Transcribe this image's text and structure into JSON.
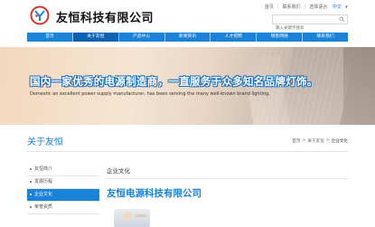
{
  "header": {
    "company_name": "友恒科技有限公司",
    "top_links": [
      "首页",
      "联系我们",
      "选择语言:",
      "中文"
    ],
    "search_placeholder": "输入关键字搜索"
  },
  "nav": {
    "items": [
      {
        "label": "首页",
        "active": false
      },
      {
        "label": "关于友恒",
        "active": true
      },
      {
        "label": "产品中心",
        "active": false
      },
      {
        "label": "新闻资讯",
        "active": false
      },
      {
        "label": "人才招聘",
        "active": false
      },
      {
        "label": "销售网络",
        "active": false
      },
      {
        "label": "联系我们",
        "active": false
      }
    ]
  },
  "banner": {
    "slogan_cn": "国内一家优秀的电源制造商，一直服务于众多知名品牌灯饰。",
    "slogan_en": "Domestic an excellent power supply manufacturer, has been serving the many well-known brand lighting."
  },
  "section": {
    "title": "关于友恒",
    "breadcrumb": [
      "首页",
      ">",
      "关于友恒",
      ">",
      "企业文化"
    ]
  },
  "sidebar": {
    "items": [
      {
        "label": "友恒简介",
        "active": false
      },
      {
        "label": "发展历程",
        "active": false
      },
      {
        "label": "企业文化",
        "active": true
      },
      {
        "label": "荣誉资质",
        "active": false
      }
    ]
  },
  "main": {
    "title": "企业文化",
    "heading": "友恒电源科技有限公司"
  },
  "colors": {
    "accent": "#1a82d8",
    "nav_active": "#0d62b2"
  }
}
